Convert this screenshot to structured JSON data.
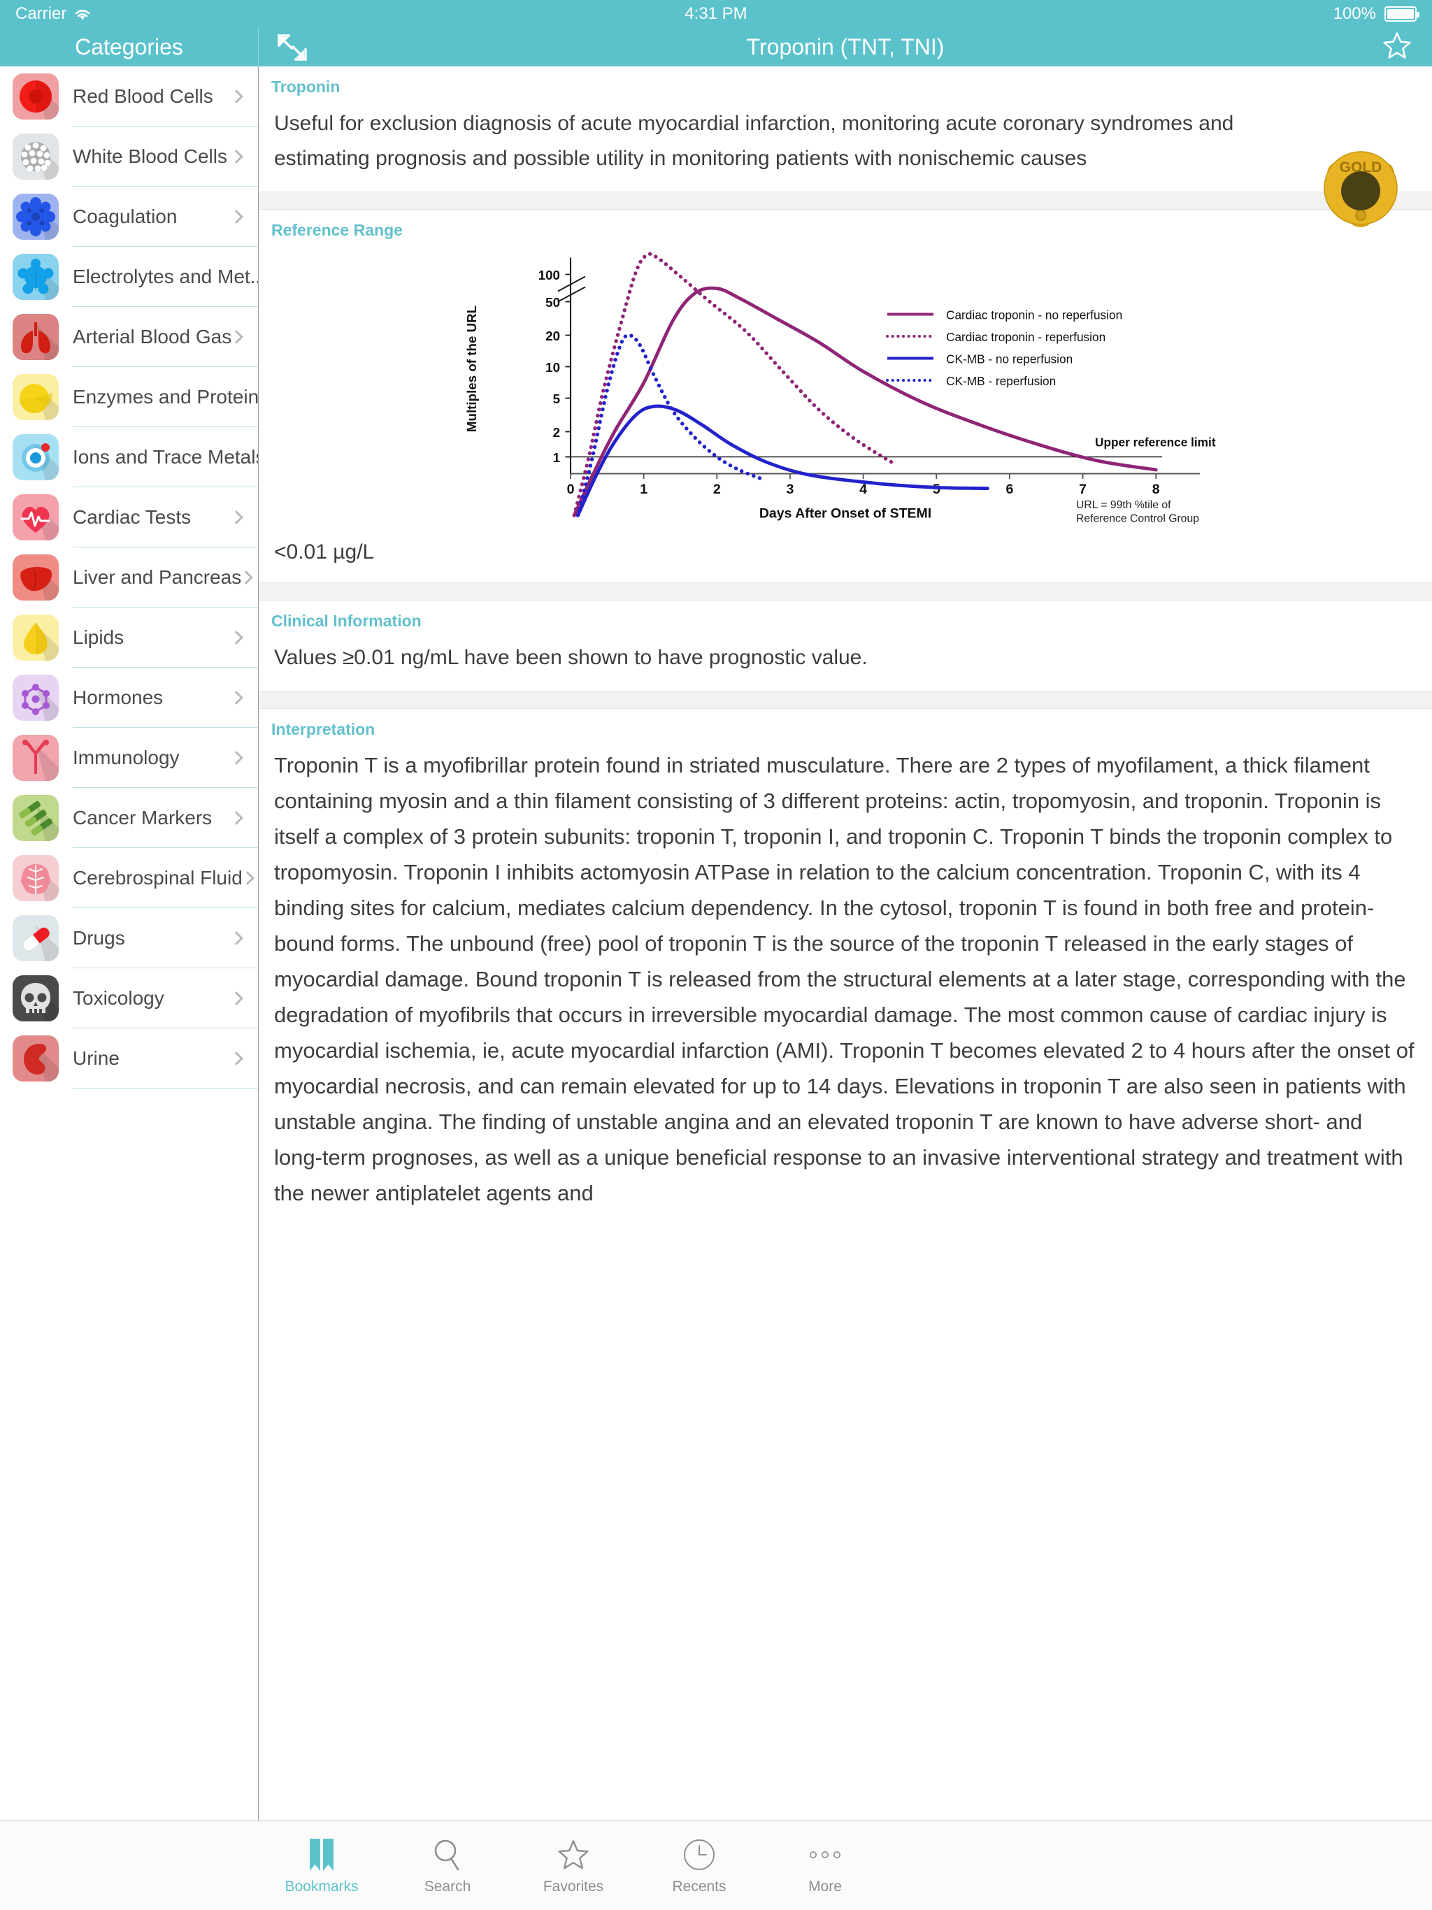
{
  "status_bar": {
    "carrier": "Carrier",
    "wifi_icon": "wifi-icon",
    "time": "4:31 PM",
    "battery_percent": "100%",
    "battery_icon": "battery-full-icon"
  },
  "sidebar": {
    "title": "Categories",
    "items": [
      {
        "label": "Red Blood Cells",
        "icon": "red-blood-cell-icon",
        "bg": "#f0a0a3",
        "fg": "#f01e17",
        "fg2": "#cf120c"
      },
      {
        "label": "White Blood Cells",
        "icon": "white-blood-cell-icon",
        "bg": "#e2e5e7",
        "fg": "#a8acaf",
        "fg2": "#ffffff"
      },
      {
        "label": "Coagulation",
        "icon": "coagulation-icon",
        "bg": "#9fb4ef",
        "fg": "#2456e8",
        "fg2": "#1b43b8"
      },
      {
        "label": "Electrolytes and Met...",
        "icon": "electrolytes-icon",
        "bg": "#8ad3ef",
        "fg": "#12a0e8",
        "fg2": "#0e86c4"
      },
      {
        "label": "Arterial Blood Gas",
        "icon": "lungs-icon",
        "bg": "#dc8484",
        "fg": "#d21d14",
        "fg2": "#b4160f"
      },
      {
        "label": "Enzymes and Proteins",
        "icon": "enzymes-icon",
        "bg": "#fbefa4",
        "fg": "#f7d417",
        "fg2": "#e3c20e"
      },
      {
        "label": "Ions and Trace Metals",
        "icon": "ions-icon",
        "bg": "#a7e0f2",
        "fg": "#1a9ad9",
        "fg2": "#e8272d"
      },
      {
        "label": "Cardiac Tests",
        "icon": "heart-ecg-icon",
        "bg": "#f4a1ab",
        "fg": "#ef3450",
        "fg2": "#ffffff"
      },
      {
        "label": "Liver and Pancreas",
        "icon": "liver-icon",
        "bg": "#ef8d85",
        "fg": "#d62016",
        "fg2": "#b51a12"
      },
      {
        "label": "Lipids",
        "icon": "lipid-drop-icon",
        "bg": "#fbefa4",
        "fg": "#f5cf1b",
        "fg2": "#e0bb10"
      },
      {
        "label": "Hormones",
        "icon": "hormones-icon",
        "bg": "#e7d4f2",
        "fg": "#a759d4",
        "fg2": "#8f46b8"
      },
      {
        "label": "Immunology",
        "icon": "antibody-icon",
        "bg": "#f3a5ad",
        "fg": "#e63b52",
        "fg2": "#c92c41"
      },
      {
        "label": "Cancer Markers",
        "icon": "dna-strand-icon",
        "bg": "#c0d98d",
        "fg": "#4a8a2c",
        "fg2": "#8cbb4a"
      },
      {
        "label": "Cerebrospinal Fluid",
        "icon": "brain-icon",
        "bg": "#f6cdd3",
        "fg": "#f08a96",
        "fg2": "#ffffff"
      },
      {
        "label": "Drugs",
        "icon": "pill-capsule-icon",
        "bg": "#dfe6e9",
        "fg": "#ec1c24",
        "fg2": "#ffffff"
      },
      {
        "label": "Toxicology",
        "icon": "skull-icon",
        "bg": "#4a4a4a",
        "fg": "#e2e2e2",
        "fg2": "#4a4a4a"
      },
      {
        "label": "Urine",
        "icon": "kidney-icon",
        "bg": "#e28a8a",
        "fg": "#cf2b24",
        "fg2": "#b52019"
      }
    ]
  },
  "detail": {
    "nav_title": "Troponin (TNT, TNI)",
    "expand_icon": "expand-arrows-icon",
    "favorite_icon": "star-outline-icon",
    "badge": {
      "icon": "gold-medal-icon",
      "label": "GOLD",
      "color": "#e8b425"
    },
    "sections": [
      {
        "heading": "Troponin",
        "body": "Useful for  exclusion diagnosis of acute myocardial infarction, monitoring acute coronary syndromes and estimating prognosis and  possible utility in monitoring patients with nonischemic causes"
      },
      {
        "heading": "Reference Range",
        "value": "<0.01 µg/L"
      },
      {
        "heading": "Clinical Information",
        "body": "Values ≥0.01 ng/mL have been shown to have prognostic value."
      },
      {
        "heading": "Interpretation",
        "body": "Troponin T is a myofibrillar protein found in striated musculature.   There are 2 types of myofilament, a thick filament containing   myosin and a thin filament consisting of 3 different proteins: actin,   tropomyosin, and troponin. Troponin is itself a complex of 3 protein   subunits: troponin T, troponin I, and troponin C. Troponin T binds  the troponin complex to tropomyosin. Troponin I inhibits actomyosin   ATPase in relation to the calcium concentration. Troponin C, with its   4 binding sites for calcium, mediates calcium dependency.  In the cytosol, troponin T is found in both free and protein-bound forms.   The unbound (free) pool of troponin T is the source of the troponin T   released in the early stages of myocardial damage. Bound troponin T   is released from the structural elements at a later stage, corresponding   with the degradation of myofibrils that occurs in irreversible myocardial   damage. The most common cause of cardiac injury is myocardial ischemia,   ie, acute myocardial infarction (AMI). Troponin T becomes elevated 2 to 4   hours after the onset of myocardial necrosis, and can remain elevated for   up to 14 days.  Elevations in troponin T are also seen in patients with unstable angina.   The finding of unstable angina and an elevated troponin T are known   to have adverse short- and long-term prognoses, as well as a unique   beneficial response to an invasive interventional strategy and treatment   with the newer antiplatelet agents and"
      }
    ]
  },
  "chart_data": {
    "type": "line",
    "title": "",
    "xlabel": "Days After Onset of STEMI",
    "ylabel": "Multiples of the URL",
    "x_ticks": [
      "0",
      "1",
      "2",
      "3",
      "4",
      "5",
      "6",
      "7",
      "8"
    ],
    "y_ticks": [
      "1",
      "2",
      "5",
      "10",
      "20",
      "50",
      "100"
    ],
    "xlim": [
      0,
      8
    ],
    "grid": false,
    "axis_break": true,
    "legend_position": "right",
    "annotations": [
      {
        "text": "Upper reference limit",
        "y_value": 1
      },
      {
        "text": "URL = 99th %tile of\nReference Control Group"
      }
    ],
    "annotation_line1": "URL = 99th %tile of",
    "annotation_line2": "Reference Control Group",
    "upper_reference_limit_label": "Upper reference limit",
    "series": [
      {
        "name": "Cardiac troponin - no reperfusion",
        "color": "#8e2576",
        "style": "solid",
        "points": [
          [
            0.05,
            0.2
          ],
          [
            0.3,
            0.6
          ],
          [
            0.6,
            2
          ],
          [
            1.0,
            7
          ],
          [
            1.4,
            30
          ],
          [
            1.7,
            62
          ],
          [
            2.0,
            70
          ],
          [
            2.3,
            55
          ],
          [
            2.8,
            32
          ],
          [
            3.4,
            17
          ],
          [
            4.0,
            9
          ],
          [
            4.8,
            4.5
          ],
          [
            5.6,
            2.4
          ],
          [
            6.4,
            1.4
          ],
          [
            7.2,
            0.9
          ],
          [
            8.0,
            0.7
          ]
        ]
      },
      {
        "name": "Cardiac troponin - reperfusion",
        "color": "#8e2576",
        "style": "dotted",
        "points": [
          [
            0.05,
            0.2
          ],
          [
            0.25,
            1
          ],
          [
            0.45,
            6
          ],
          [
            0.7,
            30
          ],
          [
            0.9,
            110
          ],
          [
            1.05,
            165
          ],
          [
            1.2,
            150
          ],
          [
            1.5,
            95
          ],
          [
            1.9,
            50
          ],
          [
            2.4,
            22
          ],
          [
            2.9,
            9
          ],
          [
            3.4,
            3.6
          ],
          [
            3.9,
            1.6
          ],
          [
            4.4,
            0.85
          ]
        ]
      },
      {
        "name": "CK-MB - no reperfusion",
        "color": "#2222cc",
        "style": "solid",
        "points": [
          [
            0.1,
            0.2
          ],
          [
            0.35,
            0.6
          ],
          [
            0.6,
            1.5
          ],
          [
            0.9,
            3.2
          ],
          [
            1.15,
            4.0
          ],
          [
            1.45,
            3.6
          ],
          [
            1.8,
            2.4
          ],
          [
            2.2,
            1.4
          ],
          [
            2.7,
            0.85
          ],
          [
            3.3,
            0.6
          ],
          [
            4.2,
            0.48
          ],
          [
            5.0,
            0.43
          ],
          [
            5.7,
            0.42
          ]
        ]
      },
      {
        "name": "CK-MB - reperfusion",
        "color": "#2222cc",
        "style": "dotted",
        "points": [
          [
            0.1,
            0.2
          ],
          [
            0.3,
            1.0
          ],
          [
            0.5,
            6
          ],
          [
            0.68,
            16
          ],
          [
            0.8,
            20
          ],
          [
            0.95,
            16
          ],
          [
            1.15,
            8
          ],
          [
            1.4,
            3.5
          ],
          [
            1.7,
            1.7
          ],
          [
            2.0,
            1.0
          ],
          [
            2.3,
            0.7
          ],
          [
            2.6,
            0.55
          ]
        ]
      }
    ]
  },
  "tabbar": {
    "items": [
      {
        "label": "Bookmarks",
        "icon": "bookmarks-icon",
        "active": true
      },
      {
        "label": "Search",
        "icon": "search-icon",
        "active": false
      },
      {
        "label": "Favorites",
        "icon": "star-icon",
        "active": false
      },
      {
        "label": "Recents",
        "icon": "clock-icon",
        "active": false
      },
      {
        "label": "More",
        "icon": "ellipsis-icon",
        "active": false
      }
    ]
  },
  "theme": {
    "accent": "#5bc2cc",
    "heading": "#63c0cc",
    "text": "#3d3d3d"
  }
}
